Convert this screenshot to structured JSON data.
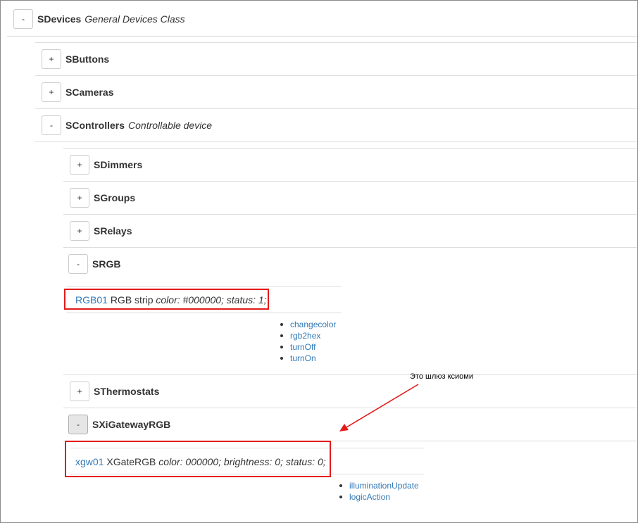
{
  "tree": {
    "root": {
      "toggle": "-",
      "name": "SDevices",
      "desc": "General Devices Class"
    },
    "level1": [
      {
        "toggle": "+",
        "name": "SButtons"
      },
      {
        "toggle": "+",
        "name": "SCameras"
      },
      {
        "toggle": "-",
        "name": "SControllers",
        "desc": "Controllable device"
      }
    ],
    "level2": [
      {
        "toggle": "+",
        "name": "SDimmers"
      },
      {
        "toggle": "+",
        "name": "SGroups"
      },
      {
        "toggle": "+",
        "name": "SRelays"
      },
      {
        "toggle": "-",
        "name": "SRGB"
      },
      {
        "toggle": "+",
        "name": "SThermostats"
      },
      {
        "toggle": "-",
        "name": "SXiGatewayRGB"
      }
    ]
  },
  "devices": {
    "rgb": {
      "id": "RGB01",
      "title": "RGB strip",
      "props": "color: #000000; status: 1;",
      "methods": [
        "changecolor",
        "rgb2hex",
        "turnOff",
        "turnOn"
      ]
    },
    "xgw": {
      "id": "xgw01",
      "title": "XGateRGB",
      "props": "color: 000000; brightness: 0; status: 0;",
      "methods": [
        "illuminationUpdate",
        "logicAction"
      ]
    }
  },
  "annotation": {
    "text": "Это шлюз ксиоми",
    "color": "#e31b1b"
  }
}
